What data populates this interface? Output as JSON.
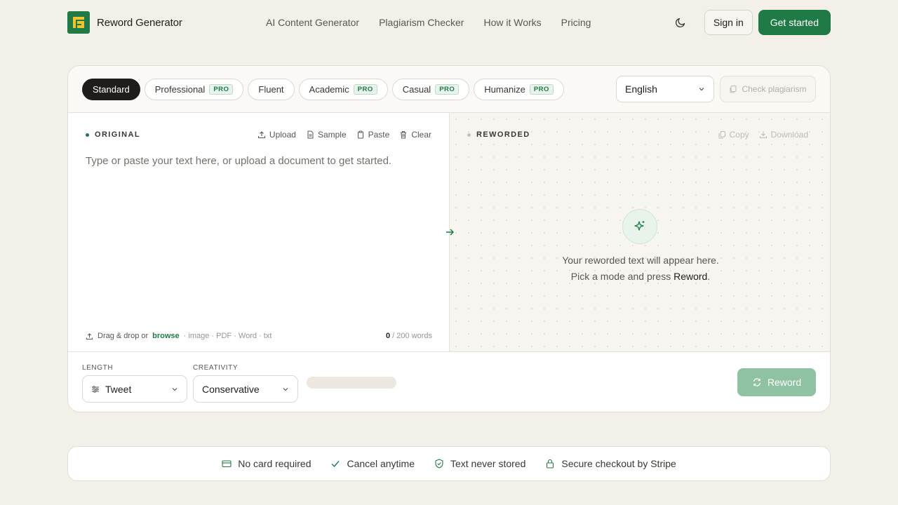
{
  "brand": {
    "name": "Reword Generator",
    "color": "#1f7a45"
  },
  "nav": [
    {
      "label": "AI Content Generator"
    },
    {
      "label": "Plagiarism Checker"
    },
    {
      "label": "How it Works"
    },
    {
      "label": "Pricing"
    }
  ],
  "header": {
    "signin": "Sign in",
    "cta": "Get started"
  },
  "modes": [
    {
      "label": "Standard",
      "pro": "",
      "active": true
    },
    {
      "label": "Professional",
      "pro": "PRO"
    },
    {
      "label": "Fluent",
      "pro": ""
    },
    {
      "label": "Academic",
      "pro": "PRO"
    },
    {
      "label": "Casual",
      "pro": "PRO"
    },
    {
      "label": "Humanize",
      "pro": "PRO"
    }
  ],
  "language": {
    "selected": "English"
  },
  "check_plagiarism": "Check plagiarism",
  "original": {
    "title": "ORIGINAL",
    "actions": {
      "upload": "Upload",
      "sample": "Sample",
      "paste": "Paste",
      "clear": "Clear"
    },
    "placeholder": "Type or paste your text here, or upload a document to get started.",
    "drop": {
      "prefix": "Drag & drop or",
      "browse": "browse",
      "formats": "· image · PDF · Word · txt"
    },
    "word_count": {
      "count": "0",
      "limit": "/ 200 words"
    }
  },
  "reworded": {
    "title": "REWORDED",
    "actions": {
      "copy": "Copy",
      "download": "Download"
    },
    "empty_line1": "Your reworded text will appear here.",
    "empty_line2_prefix": "Pick a mode and press ",
    "empty_line2_bold": "Reword",
    "empty_line2_suffix": "."
  },
  "controls": {
    "length_label": "LENGTH",
    "length_value": "Tweet",
    "creativity_label": "CREATIVITY",
    "creativity_value": "Conservative",
    "reword_button": "Reword"
  },
  "trust": [
    {
      "icon": "card-icon",
      "label": "No card required"
    },
    {
      "icon": "check-icon",
      "label": "Cancel anytime"
    },
    {
      "icon": "shield-check-icon",
      "label": "Text never stored"
    },
    {
      "icon": "lock-icon",
      "label": "Secure checkout by Stripe"
    }
  ]
}
